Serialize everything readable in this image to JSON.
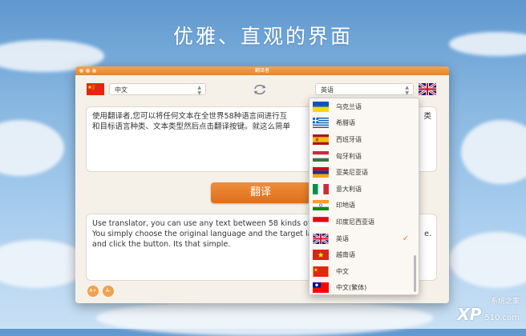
{
  "headline": "优雅、直观的界面",
  "window": {
    "title": "翻译者",
    "source_language": "中文",
    "target_language": "英语",
    "translate_button": "翻译",
    "font_increase": "A+",
    "font_decrease": "A-"
  },
  "input_text": "使用翻译者,您可以将任何文本在全世界58种语言间进行互",
  "input_text_line2": "和目标语言种类、文本类型然后点击翻译按键。就这么简单",
  "input_text_tail": "类",
  "output_text": "Use translator, you can use any text between 58 kinds of la",
  "output_text_line2": "You simply choose the original language and the target lang",
  "output_text_line3": "and click the button. Its that simple.",
  "output_text_tail": "e.",
  "dropdown": {
    "items": [
      {
        "label": "乌克兰语",
        "flag": "ukraine-flag-icon"
      },
      {
        "label": "希腊语",
        "flag": "greece-flag-icon"
      },
      {
        "label": "西班牙语",
        "flag": "spain-flag-icon"
      },
      {
        "label": "匈牙利语",
        "flag": "hungary-flag-icon"
      },
      {
        "label": "亚美尼亚语",
        "flag": "armenia-flag-icon"
      },
      {
        "label": "意大利语",
        "flag": "italy-flag-icon"
      },
      {
        "label": "印地语",
        "flag": "india-flag-icon"
      },
      {
        "label": "印度尼西亚语",
        "flag": "indonesia-flag-icon"
      },
      {
        "label": "英语",
        "flag": "uk-flag-icon",
        "selected": true
      },
      {
        "label": "越南语",
        "flag": "vietnam-flag-icon"
      },
      {
        "label": "中文",
        "flag": "china-flag-icon"
      },
      {
        "label": "中文(繁体)",
        "flag": "taiwan-flag-icon"
      }
    ],
    "check_mark": "✓"
  },
  "watermark": {
    "logo": "XP",
    "text": "系统之家",
    "sub": "510.com"
  }
}
